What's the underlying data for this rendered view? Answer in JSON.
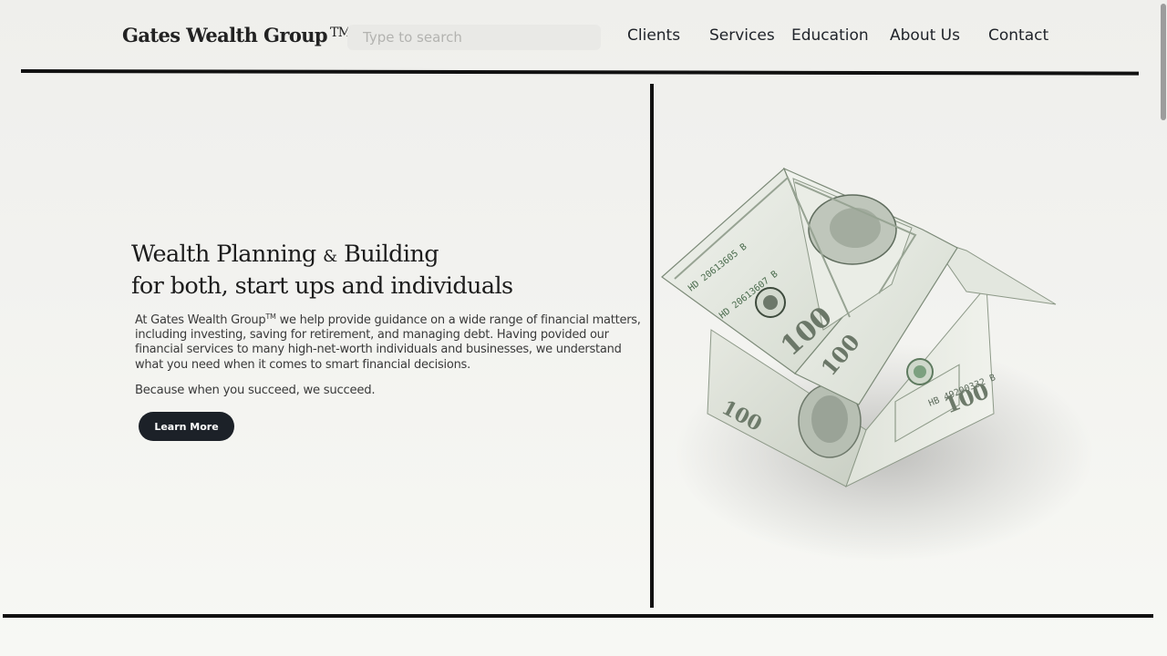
{
  "header": {
    "brand": "Gates Wealth Group",
    "brand_mark": "TM",
    "search_placeholder": "Type to search",
    "nav": [
      {
        "label": "Clients"
      },
      {
        "label": "Services"
      },
      {
        "label": "Education"
      },
      {
        "label": "About Us"
      },
      {
        "label": "Contact"
      }
    ]
  },
  "hero": {
    "title_line1_a": "Wealth Planning",
    "title_amp": "&",
    "title_line1_b": "Building",
    "title_line2": "for both, start ups and individuals",
    "desc_prefix": "At Gates Wealth Group",
    "desc_mark": "TM",
    "desc_body": " we help provide guidance on a wide range of financial matters, including investing, saving for retirement, and managing debt. Having povided our financial services to many high-net-worth individuals and businesses, we understand what you need when it comes to smart financial decisions.",
    "tagline": "Because when you succeed, we succeed.",
    "cta_label": "Learn More"
  },
  "image": {
    "subject": "house-made-of-hundred-dollar-bills",
    "note_serials": [
      "HD 20613605 B",
      "HB 49200332 B"
    ],
    "denomination": "100"
  },
  "colors": {
    "background": "#f2f2ef",
    "button": "#1c2128",
    "rule": "#111111",
    "bill_green": "#8f9c8a"
  }
}
